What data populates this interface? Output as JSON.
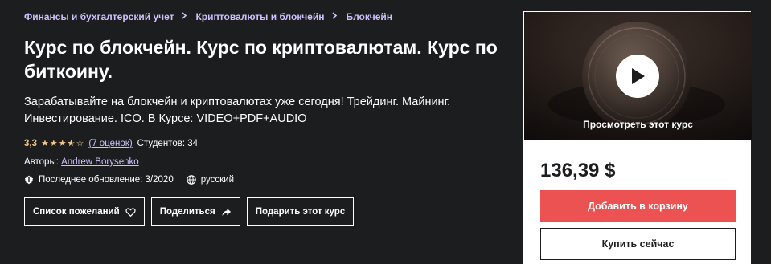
{
  "breadcrumb": {
    "items": [
      "Финансы и бухгалтерский учет",
      "Криптовалюты и блокчейн",
      "Блокчейн"
    ],
    "separator_icon": "chevron-right-icon"
  },
  "course": {
    "title": "Курс по блокчейн. Курс по криптовалютам. Курс по биткоину.",
    "subtitle": "Зарабатывайте на блокчейн и криптовалютах уже сегодня! Трейдинг. Майнинг. Инвестирование. ICO. В Курсе: VIDEO+PDF+AUDIO"
  },
  "rating": {
    "value_label": "3,3",
    "stars": 3.5,
    "reviews_label": "(7 оценок)",
    "students_label": "Студентов: 34"
  },
  "authors": {
    "label": "Авторы:",
    "name": "Andrew Borysenko"
  },
  "meta": {
    "updated_label": "Последнее обновление: 3/2020",
    "updated_icon": "alert-badge-icon",
    "language_label": "русский",
    "language_icon": "globe-icon"
  },
  "actions": {
    "wishlist_label": "Список пожеланий",
    "wishlist_icon": "heart-icon",
    "share_label": "Поделиться",
    "share_icon": "share-arrow-icon",
    "gift_label": "Подарить этот курс"
  },
  "sidebar": {
    "preview_label": "Просмотреть этот курс",
    "play_icon": "play-icon",
    "price": "136,39 $",
    "add_to_cart_label": "Добавить в корзину",
    "buy_now_label": "Купить сейчас"
  },
  "colors": {
    "background": "#1c1d1f",
    "link": "#cec0fc",
    "star": "#f3ca8c",
    "cart_button": "#ec5252"
  }
}
